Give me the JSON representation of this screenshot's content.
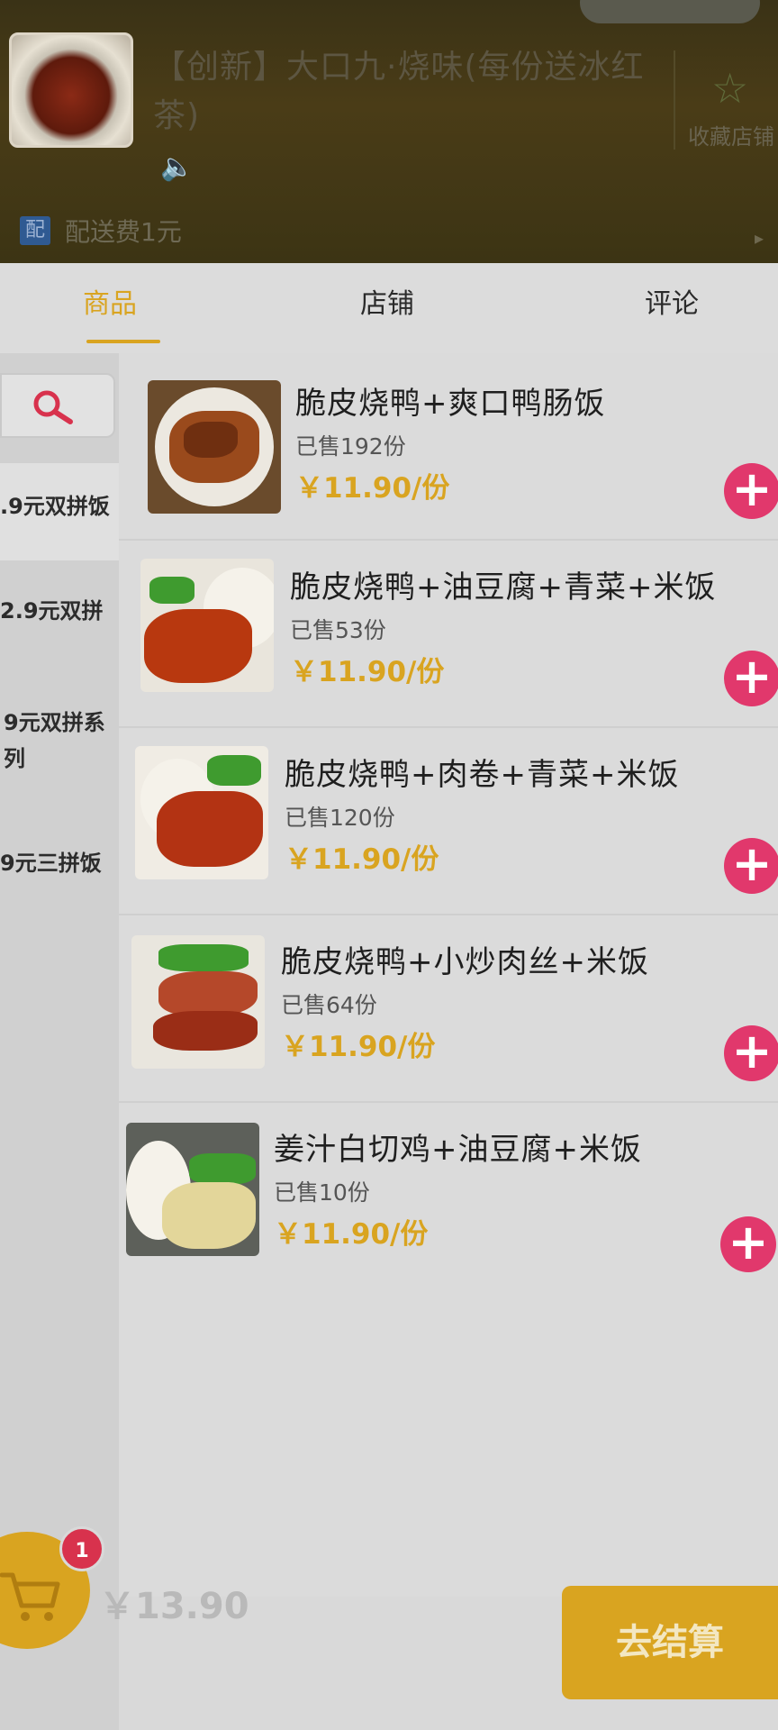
{
  "store": {
    "name": "【创新】大口九·烧味(每份送冰红茶)",
    "delivery_fee": "配送费1元",
    "delivery_badge": "配",
    "favorite_label": "收藏店铺"
  },
  "tabs": [
    {
      "label": "商品",
      "active": true
    },
    {
      "label": "店铺",
      "active": false
    },
    {
      "label": "评论",
      "active": false
    }
  ],
  "categories": [
    {
      "label": ".9元双拼饭",
      "selected": true
    },
    {
      "label": "2.9元双拼",
      "selected": false
    },
    {
      "label": "9元双拼系列",
      "selected": false
    },
    {
      "label": "9元三拼饭",
      "selected": false
    }
  ],
  "products": [
    {
      "name": "脆皮烧鸭+爽口鸭肠饭",
      "sold": "已售192份",
      "price": "￥11.90/份"
    },
    {
      "name": "脆皮烧鸭+油豆腐+青菜+米饭",
      "sold": "已售53份",
      "price": "￥11.90/份"
    },
    {
      "name": "脆皮烧鸭+肉卷+青菜+米饭",
      "sold": "已售120份",
      "price": "￥11.90/份"
    },
    {
      "name": "脆皮烧鸭+小炒肉丝+米饭",
      "sold": "已售64份",
      "price": "￥11.90/份"
    },
    {
      "name": "姜汁白切鸡+油豆腐+米饭",
      "sold": "已售10份",
      "price": "￥11.90/份"
    }
  ],
  "cart": {
    "count": "1",
    "total": "￥13.90",
    "checkout_label": "去结算"
  },
  "colors": {
    "accent": "#d9a420",
    "add_button": "#e1386c",
    "badge": "#d8324d"
  }
}
